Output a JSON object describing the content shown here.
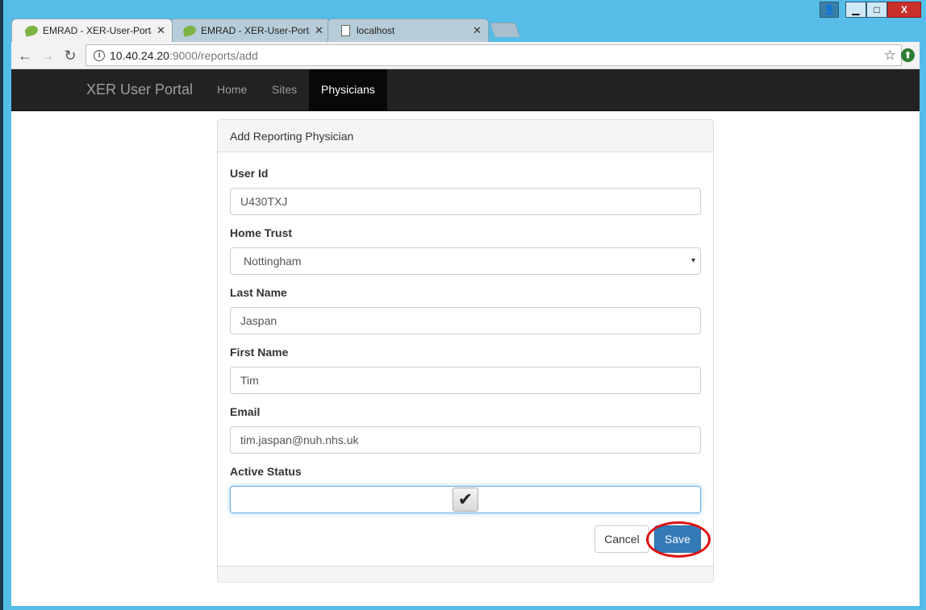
{
  "window": {
    "controls": {
      "user": "👤",
      "minimize": "▁",
      "maximize": "□",
      "close": "X"
    }
  },
  "tabs": [
    {
      "label": "EMRAD - XER-User-Portal",
      "close": "✕",
      "active": true,
      "icon": "spring-leaf-icon"
    },
    {
      "label": "EMRAD - XER-User-Portal",
      "close": "✕",
      "active": false,
      "icon": "spring-leaf-icon"
    },
    {
      "label": "localhost",
      "close": "✕",
      "active": false,
      "icon": "document-icon"
    }
  ],
  "toolbar": {
    "back": "←",
    "forward": "→",
    "reload": "↻",
    "url_host": "10.40.24.20",
    "url_path": ":9000/reports/add",
    "info": "i",
    "star": "☆",
    "extension": "⬆"
  },
  "navbar": {
    "brand": "XER User Portal",
    "links": [
      {
        "label": "Home",
        "active": false
      },
      {
        "label": "Sites",
        "active": false
      },
      {
        "label": "Physicians",
        "active": true
      }
    ]
  },
  "panel": {
    "heading": "Add Reporting Physician",
    "fields": {
      "user_id": {
        "label": "User Id",
        "value": "U430TXJ"
      },
      "home_trust": {
        "label": "Home Trust",
        "value": "Nottingham",
        "caret": "▾"
      },
      "last_name": {
        "label": "Last Name",
        "value": "Jaspan"
      },
      "first_name": {
        "label": "First Name",
        "value": "Tim"
      },
      "email": {
        "label": "Email",
        "value": "tim.jaspan@nuh.nhs.uk"
      },
      "active_status": {
        "label": "Active Status",
        "checked": true,
        "check_glyph": "✔"
      }
    },
    "buttons": {
      "cancel": "Cancel",
      "save": "Save"
    }
  },
  "colors": {
    "navbar_bg": "#222222",
    "primary_button": "#337ab7",
    "highlight_ring": "#e01010",
    "window_frame": "#55bde8"
  }
}
